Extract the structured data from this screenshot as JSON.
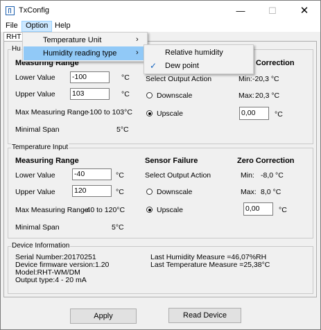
{
  "window": {
    "title": "TxConfig",
    "minimize": "—",
    "maximize": "☐",
    "close": "✕"
  },
  "menubar": [
    {
      "label": "File"
    },
    {
      "label": "Option"
    },
    {
      "label": "Help"
    }
  ],
  "option_menu": {
    "items": [
      {
        "label": "Temperature Unit",
        "arrow": "›"
      },
      {
        "label": "Humidity reading type",
        "arrow": "›"
      }
    ]
  },
  "humidity_submenu": {
    "items": [
      {
        "label": "Relative humidity",
        "checked": false
      },
      {
        "label": "Dew point",
        "checked": true,
        "check": "✓"
      }
    ]
  },
  "tab": {
    "label": "RHT"
  },
  "humidity_input": {
    "group_label": "Hu",
    "heading_measuring": "Measuring Range",
    "heading_correction": "Correction",
    "lower_label": "Lower Value",
    "lower_value": "-100",
    "lower_unit": "°C",
    "upper_label": "Upper Value",
    "upper_value": "103",
    "upper_unit": "°C",
    "max_range_label": "Max Measuring Range",
    "max_range_value": "-100 to 103°C",
    "minimal_span_label": "Minimal Span",
    "minimal_span_value": "5°C",
    "select_output_label": "Select Output Action",
    "downscale_label": "Downscale",
    "upscale_label": "Upscale",
    "min_label": "Min:",
    "min_value": "-20,3 °C",
    "max_label": "Max:",
    "max_value": "20,3 °C",
    "offset_value": "0,00",
    "offset_unit": "°C"
  },
  "temperature_input": {
    "group_label": "Temperature Input",
    "heading_measuring": "Measuring Range",
    "heading_sensor": "Sensor Failure",
    "heading_correction": "Zero Correction",
    "lower_label": "Lower Value",
    "lower_value": "-40",
    "lower_unit": "°C",
    "upper_label": "Upper Value",
    "upper_value": "120",
    "upper_unit": "°C",
    "max_range_label": "Max Measuring Range",
    "max_range_value": "-40 to 120°C",
    "minimal_span_label": "Minimal Span",
    "minimal_span_value": "5°C",
    "select_output_label": "Select Output Action",
    "downscale_label": "Downscale",
    "upscale_label": "Upscale",
    "min_label": "Min:",
    "min_value": "-8,0 °C",
    "max_label": "Max:",
    "max_value": "8,0 °C",
    "offset_value": "0,00",
    "offset_unit": "°C"
  },
  "device_info": {
    "group_label": "Device Information",
    "serial": "Serial Number:20170251",
    "firmware": "Device firmware version:1.20",
    "model": "Model:RHT-WM/DM",
    "output": "Output type:4 - 20 mA",
    "last_humidity": "Last Humidity Measure =46,07%RH",
    "last_temperature": "Last Temperature Measure =25,38°C"
  },
  "buttons": {
    "apply": "Apply",
    "read_device": "Read Device"
  }
}
